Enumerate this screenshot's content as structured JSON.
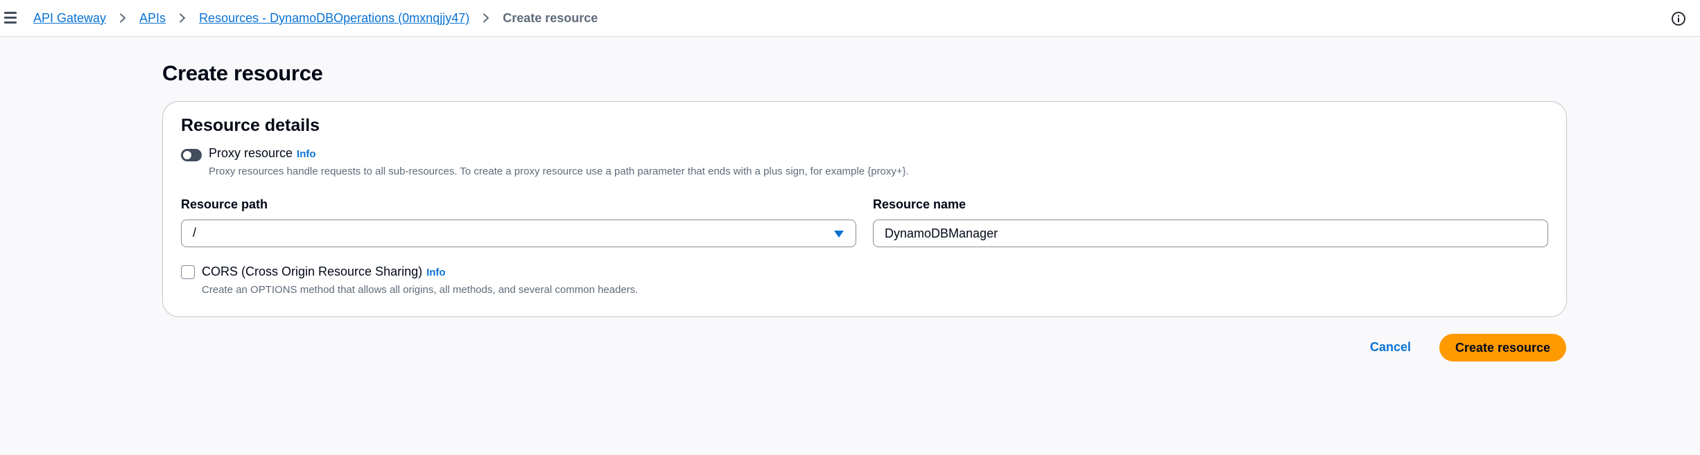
{
  "breadcrumb": {
    "items": [
      {
        "label": "API Gateway",
        "link": true
      },
      {
        "label": "APIs",
        "link": true
      },
      {
        "label": "Resources - DynamoDBOperations (0mxnqjjy47)",
        "link": true
      },
      {
        "label": "Create resource",
        "link": false
      }
    ]
  },
  "page": {
    "title": "Create resource"
  },
  "resource_details": {
    "title": "Resource details",
    "proxy": {
      "label": "Proxy resource",
      "info_label": "Info",
      "description": "Proxy resources handle requests to all sub-resources. To create a proxy resource use a path parameter that ends with a plus sign, for example {proxy+}.",
      "enabled": false
    },
    "resource_path": {
      "label": "Resource path",
      "value": "/"
    },
    "resource_name": {
      "label": "Resource name",
      "value": "DynamoDBManager"
    },
    "cors": {
      "label": "CORS (Cross Origin Resource Sharing)",
      "info_label": "Info",
      "description": "Create an OPTIONS method that allows all origins, all methods, and several common headers.",
      "checked": false
    }
  },
  "actions": {
    "cancel_label": "Cancel",
    "submit_label": "Create resource"
  },
  "icons": {
    "menu": "hamburger-menu-icon",
    "separator": "chevron-right-icon",
    "help": "info-circle-icon",
    "dropdown": "caret-down-icon"
  },
  "colors": {
    "link": "#0972d3",
    "primary_button": "#ff9900",
    "text": "#000716",
    "muted_text": "#5f6b7a",
    "page_background": "#f9f9fb"
  }
}
